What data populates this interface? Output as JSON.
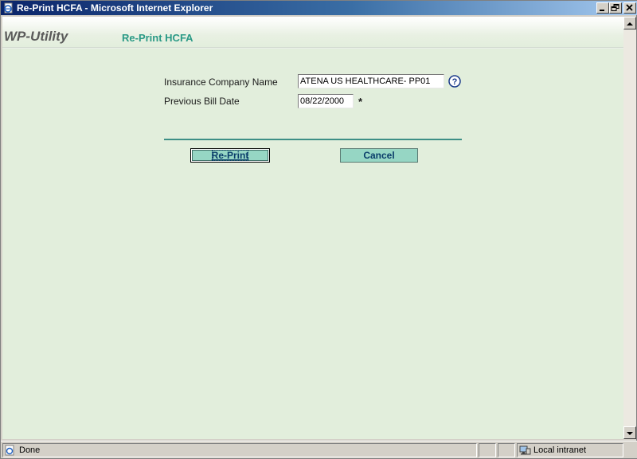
{
  "window": {
    "title": "Re-Print HCFA - Microsoft Internet Explorer",
    "controls": [
      "minimize-icon",
      "restore-icon",
      "close-icon"
    ]
  },
  "header": {
    "brand": "WP-Utility",
    "page_title": "Re-Print HCFA"
  },
  "form": {
    "insurance_label": "Insurance Company Name",
    "insurance_value": "ATENA US HEALTHCARE- PP01",
    "help_icon": "help-icon",
    "bill_date_label": "Previous Bill Date",
    "bill_date_value": "08/22/2000",
    "required_mark": "*"
  },
  "actions": {
    "reprint_label": "Re-Print",
    "cancel_label": "Cancel"
  },
  "status": {
    "text": "Done",
    "zone": "Local intranet"
  },
  "colors": {
    "background": "#e2eedc",
    "accent": "#2a9a86",
    "button": "#96d6c4",
    "rule": "#3e8f86"
  }
}
